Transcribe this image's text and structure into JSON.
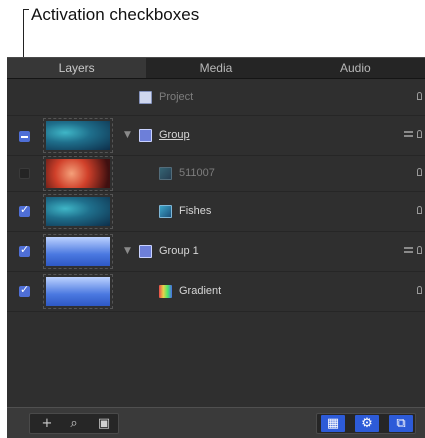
{
  "callout": {
    "text": "Activation checkboxes"
  },
  "tabs": [
    {
      "label": "Layers",
      "active": true
    },
    {
      "label": "Media",
      "active": false
    },
    {
      "label": "Audio",
      "active": false
    }
  ],
  "rows": [
    {
      "label": "Project",
      "checkbox": "none",
      "dim": true
    },
    {
      "label": "Group",
      "checkbox": "mixed"
    },
    {
      "label": "511007",
      "checkbox": "off",
      "dim": true
    },
    {
      "label": "Fishes",
      "checkbox": "on"
    },
    {
      "label": "Group 1",
      "checkbox": "on"
    },
    {
      "label": "Gradient",
      "checkbox": "on"
    }
  ],
  "footer": {
    "add_icon": "plus-icon",
    "search_icon": "search-icon",
    "clip_icon": "frame-icon",
    "right_icons": [
      "grid-icon",
      "gear-icon",
      "layers-icon"
    ]
  },
  "colors": {
    "accent": "#2d5bd8",
    "panel_bg": "#2f2f2f"
  }
}
